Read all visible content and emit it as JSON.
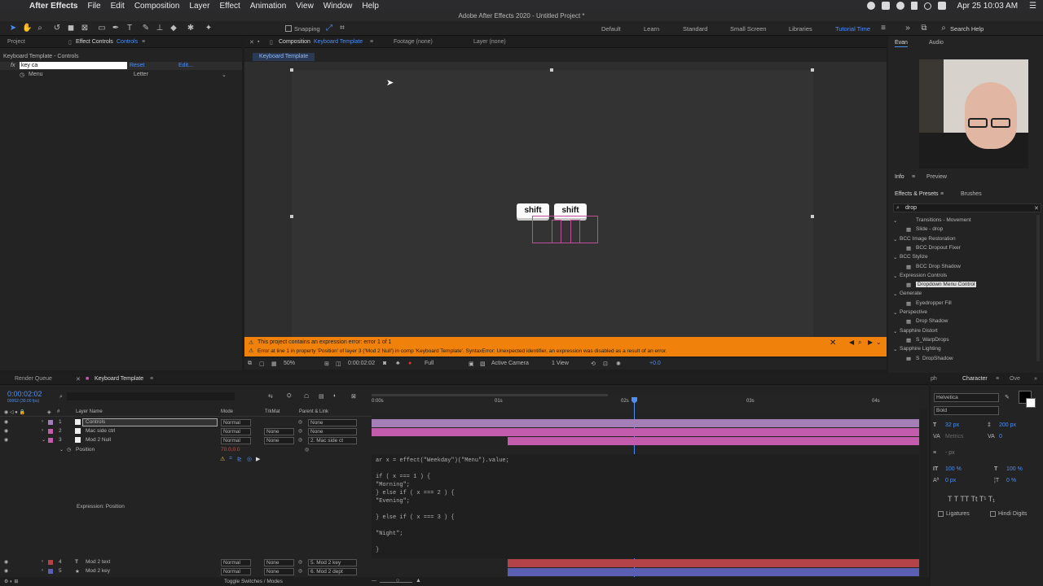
{
  "menubar": {
    "app": "After Effects",
    "items": [
      "File",
      "Edit",
      "Composition",
      "Layer",
      "Effect",
      "Animation",
      "View",
      "Window",
      "Help"
    ],
    "clock": "Apr 25  10:03 AM"
  },
  "window_title": "Adobe After Effects 2020 - Untitled Project *",
  "toolbar": {
    "snapping_label": "Snapping",
    "workspaces": [
      "Default",
      "Learn",
      "Standard",
      "Small Screen",
      "Libraries",
      "Tutorial Time"
    ],
    "active_workspace": "Tutorial Time",
    "search_help": "Search Help"
  },
  "left_panel": {
    "tab_project": "Project",
    "tab_effect_controls": "Effect Controls",
    "effect_controls_target": "Controls",
    "subtitle": "Keyboard Template - Controls",
    "effect_name": "key ca",
    "reset_label": "Reset",
    "edit_label": "Edit...",
    "menu_label": "Menu",
    "menu_value": "Letter"
  },
  "comp_tabs": {
    "composition_label": "Composition",
    "composition_name": "Keyboard Template",
    "footage": "Footage (none)",
    "layer": "Layer (none)",
    "breadcrumb": "Keyboard Template"
  },
  "canvas": {
    "key1": "shift",
    "key2": "shift"
  },
  "error": {
    "line1": "This project contains an expression error: error 1 of 1",
    "line2": "Error at line 1 in property 'Position' of layer 3 ('Mod 2 Null') in comp 'Keyboard Template'. SyntaxError: Unexpected identifier, an expression was disabled as a result of an error."
  },
  "viewer_controls": {
    "zoom": "50%",
    "timecode": "0:00:02:02",
    "resolution": "Full",
    "camera": "Active Camera",
    "views": "1 View",
    "exposure": "+0.0"
  },
  "right_panel": {
    "tab_user": "Evan",
    "tab_audio": "Audio",
    "tab_info": "Info",
    "tab_preview": "Preview",
    "tab_effects": "Effects & Presets",
    "tab_brushes": "Brushes",
    "search_value": "drop",
    "tree": [
      {
        "type": "item",
        "label": "Transitions - Movement"
      },
      {
        "type": "leaf",
        "label": "Slide - drop"
      },
      {
        "type": "folder",
        "label": "BCC Image Restoration"
      },
      {
        "type": "leaf",
        "label": "BCC Dropout Fixer"
      },
      {
        "type": "folder",
        "label": "BCC Stylize"
      },
      {
        "type": "leaf",
        "label": "BCC Drop Shadow"
      },
      {
        "type": "folder",
        "label": "Expression Controls"
      },
      {
        "type": "leaf",
        "label": "Dropdown Menu Control",
        "selected": true
      },
      {
        "type": "folder",
        "label": "Generate"
      },
      {
        "type": "leaf",
        "label": "Eyedropper Fill"
      },
      {
        "type": "folder",
        "label": "Perspective"
      },
      {
        "type": "leaf",
        "label": "Drop Shadow"
      },
      {
        "type": "folder",
        "label": "Sapphire Distort"
      },
      {
        "type": "leaf",
        "label": "S_WarpDrops"
      },
      {
        "type": "folder",
        "label": "Sapphire Lighting"
      },
      {
        "type": "leaf",
        "label": "S_DropShadow"
      }
    ]
  },
  "timeline": {
    "tab_render": "Render Queue",
    "tab_comp": "Keyboard Template",
    "timecode": "0:00:02:02",
    "frame_info": "00062 (30.00 fps)",
    "col_layer_name": "Layer Name",
    "col_mode": "Mode",
    "col_trkmat": "TrkMat",
    "col_parent": "Parent & Link",
    "ruler": [
      "0:00s",
      "01s",
      "02s",
      "03s",
      "04s"
    ],
    "layers": [
      {
        "num": "1",
        "name": "Controls",
        "mode": "Normal",
        "trkmat": "",
        "parent": "None",
        "color": "#a47fb7"
      },
      {
        "num": "2",
        "name": "Mac side ctrl",
        "mode": "Normal",
        "trkmat": "None",
        "parent": "None",
        "color": "#c45cae"
      },
      {
        "num": "3",
        "name": "Mod 2 Null",
        "mode": "Normal",
        "trkmat": "None",
        "parent": "2. Mac side ct",
        "color": "#c45cae"
      },
      {
        "num": "4",
        "name": "Mod 2 text",
        "mode": "Normal",
        "trkmat": "None",
        "parent": "5. Mod 2 key",
        "color": "#b44249"
      },
      {
        "num": "5",
        "name": "Mod 2 key",
        "mode": "Normal",
        "trkmat": "None",
        "parent": "6. Mod 2 dept",
        "color": "#5b5fb3"
      }
    ],
    "position_label": "Position",
    "position_value": "70.0,0.0",
    "expression_label": "Expression: Position",
    "toggle_label": "Toggle Switches / Modes",
    "expression_lines": [
      "ar x = effect(\"Weekday\")(\"Menu\").value;",
      "",
      "if ( x === 1 ) {",
      "\"Morning\";",
      "} else if ( x === 2 ) {",
      "\"Evening\";",
      "",
      "} else if ( x === 3 ) {",
      "",
      "\"Night\";",
      "",
      "}"
    ]
  },
  "character": {
    "tab_graph": "ph",
    "tab_character": "Character",
    "tab_other": "Ove",
    "font": "Helvetica",
    "style": "Bold",
    "size": "32 px",
    "leading": "200 px",
    "kerning": "Metrics",
    "tracking": "0",
    "stroke": "- px",
    "vscale": "100 %",
    "hscale": "100 %",
    "baseline": "0 px",
    "tsume": "0 %",
    "ligatures": "Ligatures",
    "hindi": "Hindi Digits"
  }
}
